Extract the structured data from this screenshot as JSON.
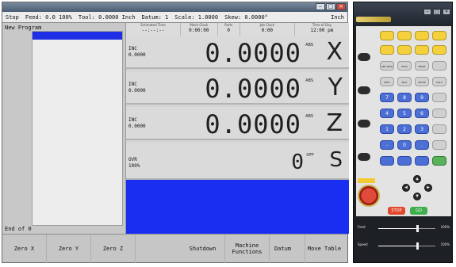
{
  "status_bar": {
    "mode": "Stop",
    "feed_label": "Feed:",
    "feed_value": "0.0 100%",
    "tool_label": "Tool:",
    "tool_value": "0.0000 Inch",
    "datum_label": "Datum:",
    "datum_value": "1",
    "scale_label": "Scale:",
    "scale_value": "1.0000",
    "skew_label": "Skew:",
    "skew_value": "0.0000°",
    "units": "Inch"
  },
  "program": {
    "title": "New Program",
    "end_text": "End of 0"
  },
  "timers": [
    {
      "label": "Estimated Time",
      "value": "--:--:--"
    },
    {
      "label": "Mach Clock",
      "value": "0:00:00"
    },
    {
      "label": "Parts",
      "value": "0"
    },
    {
      "label": "Job Clock",
      "value": "0:00"
    },
    {
      "label": "Time of Day",
      "value": "12:00 pm"
    }
  ],
  "axes": [
    {
      "name": "X",
      "mode": "INC",
      "inc_value": "0.0000",
      "value": "0.0000",
      "tag": "ABS"
    },
    {
      "name": "Y",
      "mode": "INC",
      "inc_value": "0.0000",
      "value": "0.0000",
      "tag": "ABS"
    },
    {
      "name": "Z",
      "mode": "INC",
      "inc_value": "0.0000",
      "value": "0.0000",
      "tag": "ABS"
    }
  ],
  "spindle": {
    "name": "S",
    "mode": "OVR",
    "override": "100%",
    "value": "0",
    "tag": "OFF"
  },
  "function_keys": {
    "zero_x": "Zero X",
    "zero_y": "Zero Y",
    "zero_z": "Zero Z",
    "shutdown": "Shutdown",
    "machine_functions": "Machine Functions",
    "datum": "Datum",
    "move_table": "Move Table"
  },
  "pendant": {
    "keys_row3": [
      "ABS INCR",
      "INCR POST",
      "MPGB",
      ""
    ],
    "keys_row4": [
      "INFO",
      "MAX",
      "SETUP",
      "CALC"
    ],
    "keys_num1": [
      "7",
      "8",
      "9",
      ""
    ],
    "keys_num2": [
      "4",
      "5",
      "6",
      ""
    ],
    "keys_num3": [
      "1",
      "2",
      "3",
      ""
    ],
    "keys_num4": [
      "-",
      "0",
      ".",
      ""
    ],
    "keys_bottom": [
      "",
      "",
      "",
      ""
    ],
    "stop_label": "STOP",
    "go_label": "GO",
    "feed_label": "Feed",
    "feed_value": "100%",
    "feed_level": 0.68,
    "speed_label": "Speed",
    "speed_value": "100%",
    "speed_level": 0.68
  },
  "colors": {
    "program_highlight": "#1f2fe6",
    "dro_blank": "#1a2ef2",
    "pendant_yellow": "#f4d13c",
    "pendant_blue": "#4c6fd6",
    "stop_red": "#e2482c",
    "go_green": "#3eae4e"
  }
}
